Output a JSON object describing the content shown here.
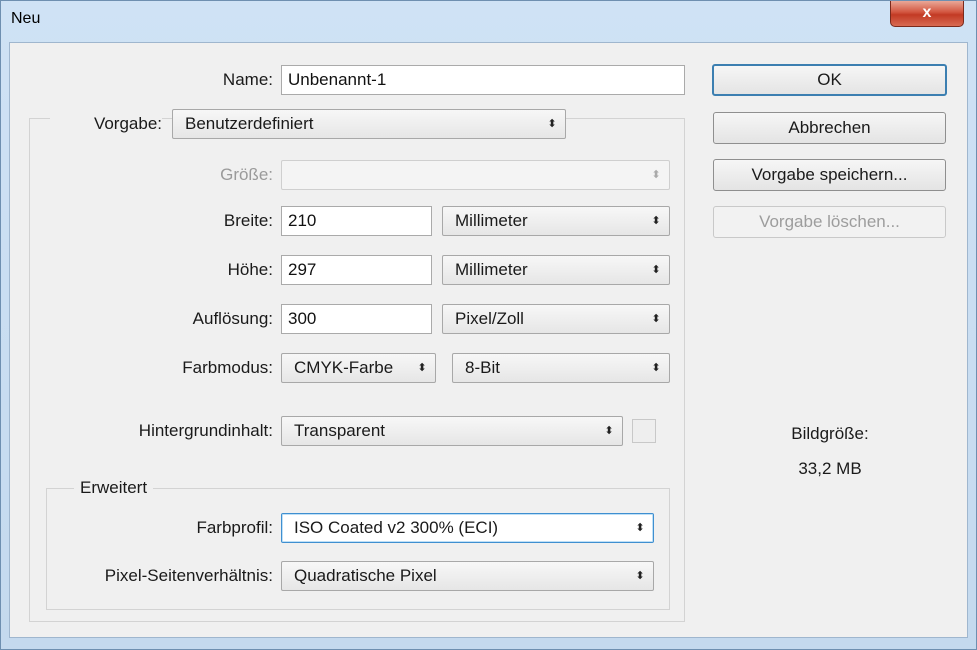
{
  "window": {
    "title": "Neu",
    "close_glyph": "x"
  },
  "form": {
    "name_label": "Name:",
    "name_value": "Unbenannt-1",
    "preset_label": "Vorgabe:",
    "preset_value": "Benutzerdefiniert",
    "size_label": "Größe:",
    "size_value": "",
    "width_label": "Breite:",
    "width_value": "210",
    "width_unit": "Millimeter",
    "height_label": "Höhe:",
    "height_value": "297",
    "height_unit": "Millimeter",
    "resolution_label": "Auflösung:",
    "resolution_value": "300",
    "resolution_unit": "Pixel/Zoll",
    "colormode_label": "Farbmodus:",
    "colormode_value": "CMYK-Farbe",
    "bitdepth_value": "8-Bit",
    "background_label": "Hintergrundinhalt:",
    "background_value": "Transparent"
  },
  "advanced": {
    "legend": "Erweitert",
    "profile_label": "Farbprofil:",
    "profile_value": "ISO Coated v2 300% (ECI)",
    "aspect_label": "Pixel-Seitenverhältnis:",
    "aspect_value": "Quadratische Pixel"
  },
  "buttons": {
    "ok": "OK",
    "cancel": "Abbrechen",
    "save_preset": "Vorgabe speichern...",
    "delete_preset": "Vorgabe löschen..."
  },
  "info": {
    "image_size_label": "Bildgröße:",
    "image_size_value": "33,2 MB"
  },
  "icons": {
    "combo_arrow": "updown-arrow-icon",
    "close": "close-icon"
  },
  "colors": {
    "title_bg": "#c9ddf0",
    "close_red": "#c23a24",
    "focus_blue": "#3f8fd0",
    "dialog_bg": "#f0f0f0"
  }
}
